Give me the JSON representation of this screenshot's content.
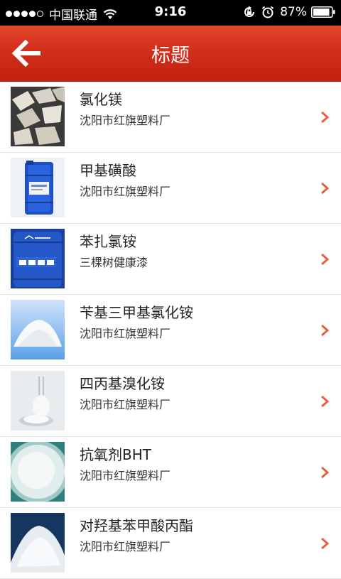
{
  "status_bar": {
    "carrier": "中国联通",
    "time": "9:16",
    "battery": "87%"
  },
  "nav": {
    "title": "标题"
  },
  "colors": {
    "nav_red": "#d22f1d",
    "chevron": "#e0643f"
  },
  "items": [
    {
      "title": "氯化镁",
      "subtitle": "沈阳市红旗塑料厂",
      "thumb": "magnesium-flakes"
    },
    {
      "title": "甲基磺酸",
      "subtitle": "沈阳市红旗塑料厂",
      "thumb": "blue-drum"
    },
    {
      "title": "苯扎氯铵",
      "subtitle": "三棵树健康漆",
      "thumb": "blue-drum-phoenix"
    },
    {
      "title": "苄基三甲基氯化铵",
      "subtitle": "沈阳市红旗塑料厂",
      "thumb": "white-powder"
    },
    {
      "title": "四丙基溴化铵",
      "subtitle": "沈阳市红旗塑料厂",
      "thumb": "powder-flask"
    },
    {
      "title": "抗氧剂BHT",
      "subtitle": "沈阳市红旗塑料厂",
      "thumb": "white-crystal-dish"
    },
    {
      "title": "对羟基苯甲酸丙酯",
      "subtitle": "沈阳市红旗塑料厂",
      "thumb": "white-granules"
    }
  ]
}
